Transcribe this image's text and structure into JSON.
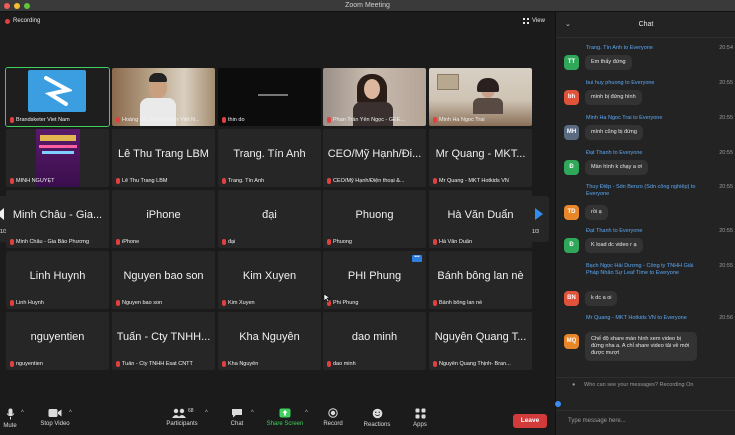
{
  "window": {
    "title": "Zoom Meeting"
  },
  "meeting": {
    "recording_label": "Recording",
    "view_label": "View",
    "page_left": "1/3",
    "page_right": "1/3"
  },
  "tiles": [
    {
      "big": "",
      "caption": "Brandsketer Viet Nam"
    },
    {
      "big": "",
      "caption": "Hoàng Lê. Brandsketer Việt N..."
    },
    {
      "big": "",
      "caption": "thin do"
    },
    {
      "big": "",
      "caption": "Phan Trần Yến Ngọc - GEE..."
    },
    {
      "big": "",
      "caption": "Minh Ha Ngoc Trai"
    },
    {
      "big": "",
      "caption": "MINH NGUYỆT"
    },
    {
      "big": "Lê Thu Trang LBM",
      "caption": "Lê Thu Trang LBM"
    },
    {
      "big": "Trang. Tín Anh",
      "caption": "Trang. Tín Anh"
    },
    {
      "big": "CEO/Mỹ Hạnh/Đi...",
      "caption": "CEO/Mỹ Hạnh/Điện thoại &..."
    },
    {
      "big": "Mr Quang - MKT...",
      "caption": "Mr Quang - MKT Hotkids VN"
    },
    {
      "big": "Minh Châu - Gia...",
      "caption": "Minh Châu - Gia Bảo Phương"
    },
    {
      "big": "iPhone",
      "caption": "iPhone"
    },
    {
      "big": "đại",
      "caption": "đại"
    },
    {
      "big": "Phuong",
      "caption": "Phuong"
    },
    {
      "big": "Hà Văn Duẩn",
      "caption": "Hà Văn Duẩn"
    },
    {
      "big": "Linh Huynh",
      "caption": "Linh Huynh"
    },
    {
      "big": "Nguyen bao son",
      "caption": "Nguyen bao son"
    },
    {
      "big": "Kim Xuyen",
      "caption": "Kim Xuyen"
    },
    {
      "big": "PHI Phung",
      "caption": "Phi Phung"
    },
    {
      "big": "Bánh bông lan nè",
      "caption": "Bánh bông lan nè"
    },
    {
      "big": "nguyentien",
      "caption": "nguyentien"
    },
    {
      "big": "Tuấn - Cty TNHH...",
      "caption": "Tuấn - Cty TNHH Esat CNTT"
    },
    {
      "big": "Kha Nguyễn",
      "caption": "Kha Nguyễn"
    },
    {
      "big": "dao minh",
      "caption": "dao minh"
    },
    {
      "big": "Nguyễn Quang T...",
      "caption": "Nguyễn Quang Thịnh- Bran..."
    }
  ],
  "toolbar": {
    "mute": "Mute",
    "stop_video": "Stop Video",
    "participants": "Participants",
    "participants_count": "68",
    "chat": "Chat",
    "share_screen": "Share Screen",
    "record": "Record",
    "reactions": "Reactions",
    "apps": "Apps",
    "leave": "Leave"
  },
  "chat": {
    "title": "Chat",
    "messages": [
      {
        "initials": "TT",
        "color": "#2fa85a",
        "from": "Trang. Tín Anh to Everyone",
        "time": "20:54",
        "text": "Em thấy đứng"
      },
      {
        "initials": "bh",
        "color": "#e0533a",
        "from": "bui huy phuong to Everyone",
        "time": "20:55",
        "text": "mình bị đứng hình"
      },
      {
        "initials": "MH",
        "color": "#5a6a80",
        "from": "Minh Ha Ngoc Trai to Everyone",
        "time": "20:55",
        "text": "mình cũng  bị đứng"
      },
      {
        "initials": "Đ",
        "color": "#2fa85a",
        "from": "Đạt Thanh to Everyone",
        "time": "20:55",
        "text": "Màn hình k chạy a ơi"
      },
      {
        "initials": "TD",
        "color": "#e8862a",
        "from": "Thuy Điệp - Sdn Benzo (Sdn công nghiệp) to Everyone",
        "time": "20:55",
        "text": "rồi ạ"
      },
      {
        "initials": "Đ",
        "color": "#2fa85a",
        "from": "Đạt Thanh to Everyone",
        "time": "20:55",
        "text": "K load dc video r ạ"
      },
      {
        "initials": "BN",
        "color": "#e0533a",
        "from": "Bạch Ngọc Hải Dương - Công ty TNHH Giải Pháp Nhân Sự Leaf Time to Everyone",
        "time": "20:55",
        "text": "k dc a oi"
      },
      {
        "initials": "MQ",
        "color": "#e8862a",
        "from": "Mr Quang - MKT Hotkids VN to Everyone",
        "time": "20:56",
        "text": "Chế độ share màn hình xem video bị đứng nha a. A chỉ share video tải về mới được mượt"
      }
    ],
    "who_can_see": "Who can see your messages? Recording On",
    "placeholder": "Type message here..."
  }
}
